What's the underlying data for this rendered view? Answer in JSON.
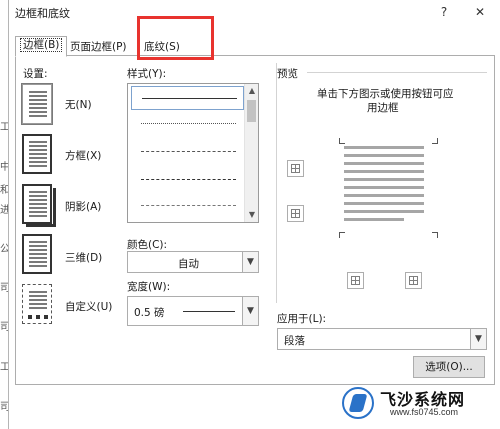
{
  "window": {
    "title": "边框和底纹",
    "help_label": "?",
    "close_label": "✕"
  },
  "tabs": [
    {
      "label": "边框(B)",
      "active": true
    },
    {
      "label": "页面边框(P)",
      "active": false
    },
    {
      "label": "底纹(S)",
      "active": false
    }
  ],
  "settings": {
    "label": "设置:",
    "items": [
      {
        "label": "无(N)",
        "selected": true
      },
      {
        "label": "方框(X)",
        "selected": false
      },
      {
        "label": "阴影(A)",
        "selected": false
      },
      {
        "label": "三维(D)",
        "selected": false
      },
      {
        "label": "自定义(U)",
        "selected": false
      }
    ]
  },
  "style": {
    "label": "样式(Y):",
    "items": [
      "solid",
      "dotted",
      "dashed-small",
      "dashed",
      "dash-dot"
    ]
  },
  "color": {
    "label": "颜色(C):",
    "value": "自动"
  },
  "width": {
    "label": "宽度(W):",
    "value": "0.5 磅"
  },
  "preview": {
    "label": "预览",
    "hint_line1": "单击下方图示或使用按钮可应",
    "hint_line2": "用边框"
  },
  "apply_to": {
    "label": "应用于(L):",
    "value": "段落"
  },
  "buttons": {
    "options": "选项(O)..."
  },
  "background_text": [
    "工",
    "中",
    "和",
    "进",
    "公",
    "司",
    "司",
    "工",
    "司"
  ],
  "watermark": {
    "name": "飞沙系统网",
    "url": "www.fs0745.com"
  },
  "colors": {
    "highlight": "#e8332e",
    "brand": "#2a72c8"
  }
}
